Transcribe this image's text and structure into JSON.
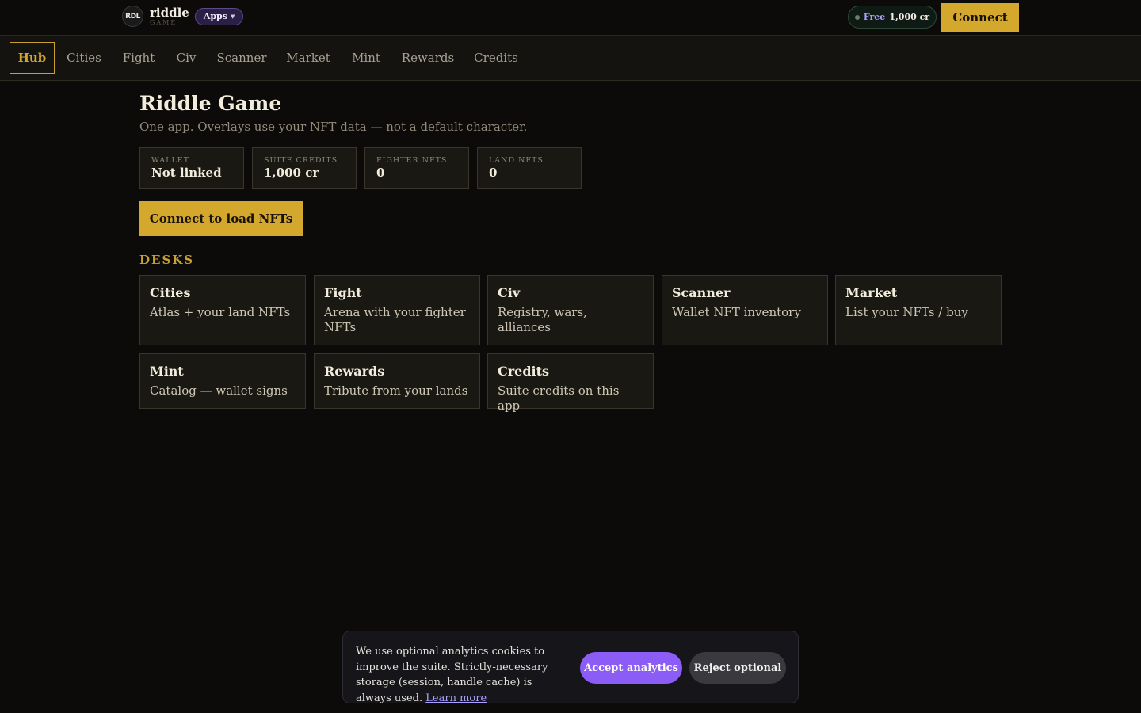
{
  "header": {
    "logo_text": "RDL",
    "brand_name": "riddle",
    "brand_sub": "GAME",
    "apps_label": "Apps",
    "free_label": "Free",
    "free_credits": "1,000 cr",
    "connect_label": "Connect"
  },
  "nav": {
    "items": [
      {
        "label": "Hub",
        "active": true
      },
      {
        "label": "Cities"
      },
      {
        "label": "Fight"
      },
      {
        "label": "Civ"
      },
      {
        "label": "Scanner"
      },
      {
        "label": "Market"
      },
      {
        "label": "Mint"
      },
      {
        "label": "Rewards"
      },
      {
        "label": "Credits"
      }
    ]
  },
  "main": {
    "title": "Riddle Game",
    "subtitle": "One app. Overlays use your NFT data — not a default character.",
    "stats": [
      {
        "label": "WALLET",
        "value": "Not linked"
      },
      {
        "label": "SUITE CREDITS",
        "value": "1,000 cr"
      },
      {
        "label": "FIGHTER NFTS",
        "value": "0"
      },
      {
        "label": "LAND NFTS",
        "value": "0"
      }
    ],
    "load_button": "Connect to load NFTs",
    "desks_title": "DESKS",
    "desks": [
      {
        "title": "Cities",
        "desc": "Atlas + your land NFTs"
      },
      {
        "title": "Fight",
        "desc": "Arena with your fighter NFTs"
      },
      {
        "title": "Civ",
        "desc": "Registry, wars, alliances"
      },
      {
        "title": "Scanner",
        "desc": "Wallet NFT inventory"
      },
      {
        "title": "Market",
        "desc": "List your NFTs / buy"
      },
      {
        "title": "Mint",
        "desc": "Catalog — wallet signs"
      },
      {
        "title": "Rewards",
        "desc": "Tribute from your lands"
      },
      {
        "title": "Credits",
        "desc": "Suite credits on this app"
      }
    ]
  },
  "cookie": {
    "text": "We use optional analytics cookies to improve the suite. Strictly-necessary storage (session, handle cache) is always used.",
    "link": "Learn more",
    "accept": "Accept analytics",
    "reject": "Reject optional"
  },
  "colors": {
    "background": "#0d0b09",
    "accent_gold": "#d4a82c",
    "accent_purple": "#8b5cf6",
    "card_bg": "#1a1813"
  }
}
